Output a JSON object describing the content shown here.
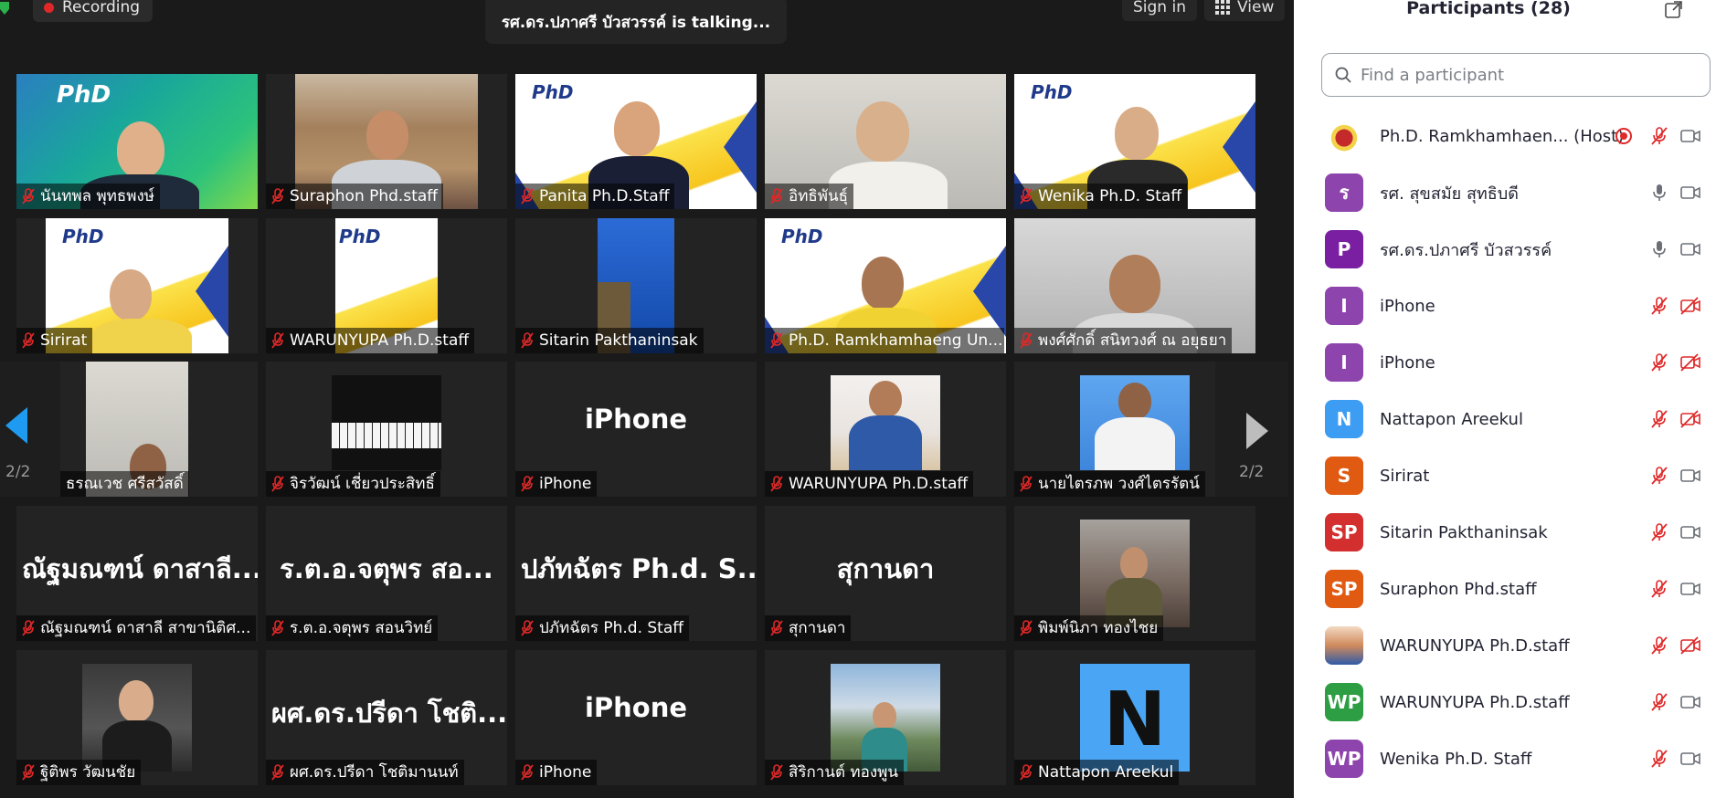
{
  "topbar": {
    "recording_label": "Recording",
    "talking": "รศ.ดร.ปภาศรี บัวสวรรค์ is  talking...",
    "signin_label": "Sign in",
    "view_label": "View"
  },
  "gallery": {
    "page_left": "2/2",
    "page_right": "2/2",
    "tiles": [
      {
        "name": "นันทพล พุทธพงษ์"
      },
      {
        "name": "Suraphon Phd.staff"
      },
      {
        "name": "Panita Ph.D.Staff"
      },
      {
        "name": "อิทธิพันธุ์"
      },
      {
        "name": "Wenika Ph.D. Staff"
      },
      {
        "name": "Sirirat"
      },
      {
        "name": "WARUNYUPA Ph.D.staff"
      },
      {
        "name": "Sitarin Pakthaninsak"
      },
      {
        "name": "Ph.D. Ramkhamhaeng Un..."
      },
      {
        "name": "พงศ์ศักดิ์ สนิทวงศ์ ณ อยุธยา"
      },
      {
        "name": "ธรณเวช ศรีสวัสดิ์"
      },
      {
        "name": "จิรวัฒน์ เชี่ยวประสิทธิ์"
      },
      {
        "name": "iPhone",
        "big": "iPhone"
      },
      {
        "name": "WARUNYUPA Ph.D.staff"
      },
      {
        "name": "นายไตรภพ วงศ์ไตรรัตน์"
      },
      {
        "name": "ณัฐมณฑน์ ดาสาลี สาขานิติศ...",
        "big": "ณัฐมณฑน์ ดาสาลี..."
      },
      {
        "name": "ร.ต.อ.จตุพร  สอนวิทย์",
        "big": "ร.ต.อ.จตุพร  สอ..."
      },
      {
        "name": "ปภัทฉัตร Ph.d. Staff",
        "big": "ปภัทฉัตร Ph.d. S..."
      },
      {
        "name": "สุกานดา",
        "big": "สุกานดา"
      },
      {
        "name": "พิมพ์นิภา ทองไชย"
      },
      {
        "name": "ฐิติพร วัฒนชัย"
      },
      {
        "name": "ผศ.ดร.ปรีดา โชติมานนท์",
        "big": "ผศ.ดร.ปรีดา โชติ..."
      },
      {
        "name": "iPhone",
        "big": "iPhone"
      },
      {
        "name": "สิริกานต์ ทองพูน"
      },
      {
        "name": "Nattapon Areekul",
        "big_letter": "N"
      }
    ]
  },
  "participants": {
    "title": "Participants (28)",
    "search_placeholder": "Find a participant",
    "list": [
      {
        "name": "Ph.D. Ramkhamhaen... (Host)",
        "initials": "",
        "color": "#ffffff",
        "mic": "muted",
        "video": "on",
        "recording": true
      },
      {
        "name": "รศ. สุขสมัย สุทธิบดี",
        "initials": "ร",
        "color": "#8e44ad",
        "mic": "on",
        "video": "on"
      },
      {
        "name": "รศ.ดร.ปภาศรี บัวสวรรค์",
        "initials": "P",
        "color": "#7b1fa2",
        "mic": "on",
        "video": "on"
      },
      {
        "name": "iPhone",
        "initials": "I",
        "color": "#8e44ad",
        "mic": "muted",
        "video": "off"
      },
      {
        "name": "iPhone",
        "initials": "I",
        "color": "#8e44ad",
        "mic": "muted",
        "video": "off"
      },
      {
        "name": "Nattapon Areekul",
        "initials": "N",
        "color": "#3d9df2",
        "mic": "muted",
        "video": "off"
      },
      {
        "name": "Sirirat",
        "initials": "S",
        "color": "#e05a12",
        "mic": "muted",
        "video": "on"
      },
      {
        "name": "Sitarin Pakthaninsak",
        "initials": "SP",
        "color": "#d32f2f",
        "mic": "muted",
        "video": "on"
      },
      {
        "name": "Suraphon Phd.staff",
        "initials": "SP",
        "color": "#e05a12",
        "mic": "muted",
        "video": "on"
      },
      {
        "name": "WARUNYUPA Ph.D.staff",
        "initials": "",
        "color": "#ffffff",
        "mic": "muted",
        "video": "off"
      },
      {
        "name": "WARUNYUPA Ph.D.staff",
        "initials": "WP",
        "color": "#2e9e44",
        "mic": "muted",
        "video": "on"
      },
      {
        "name": "Wenika Ph.D. Staff",
        "initials": "WP",
        "color": "#8e44ad",
        "mic": "muted",
        "video": "on"
      }
    ]
  },
  "colors": {
    "accent_blue": "#1e9bf0",
    "muted_red": "#e02828",
    "panel_bg": "#ffffff",
    "gallery_bg": "#1a1a1a"
  }
}
